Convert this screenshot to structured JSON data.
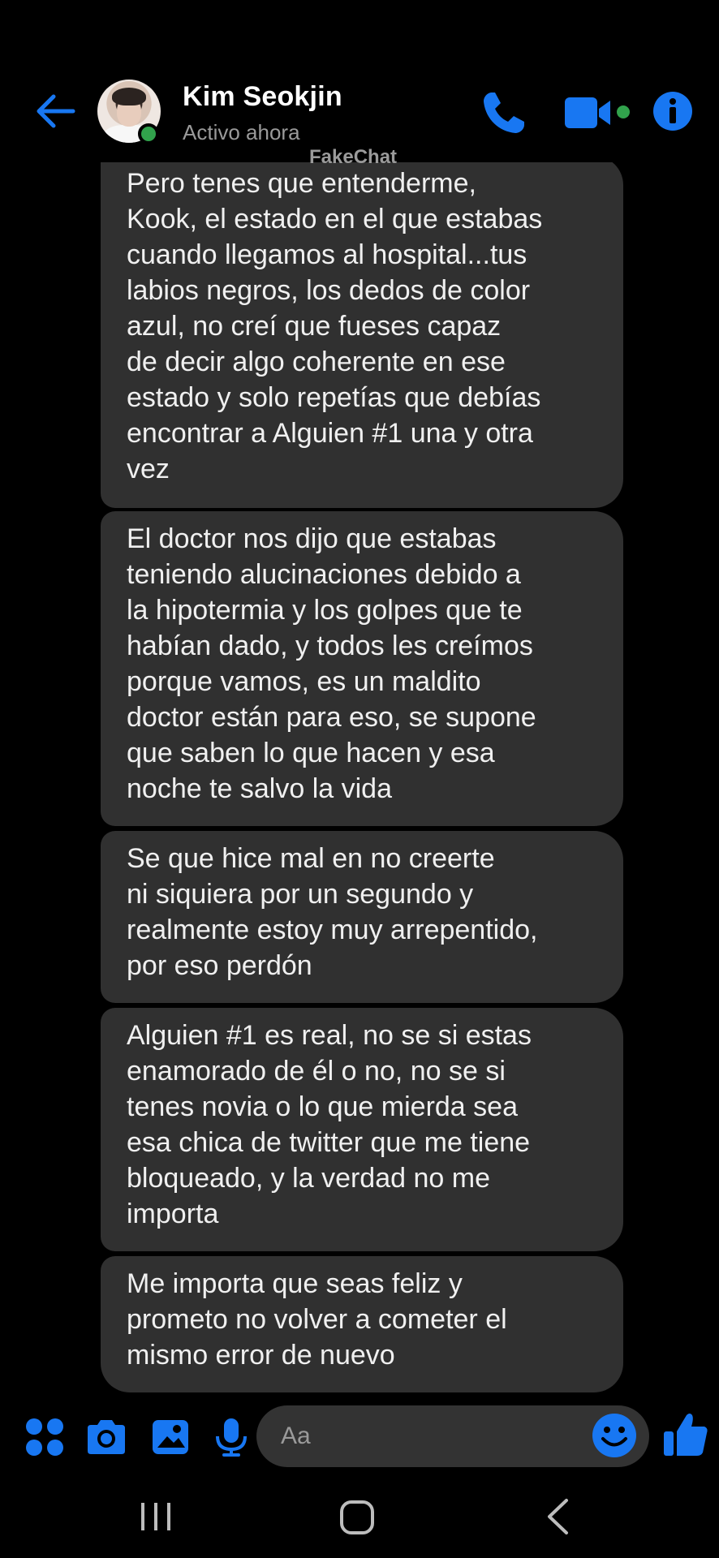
{
  "header": {
    "contact_name": "Kim Seokjin",
    "status": "Activo ahora",
    "watermark": "FakeChat",
    "icons": [
      "back-arrow-icon",
      "phone-icon",
      "video-camera-icon",
      "info-icon"
    ]
  },
  "messages": [
    {
      "text": "Pero tenes que entenderme,\nKook, el estado en el que estabas\ncuando llegamos al hospital...tus\nlabios negros, los dedos de color\nazul, no creí que fueses capaz\nde decir algo coherente en ese\nestado y solo repetías que debías\nencontrar a Alguien #1 una y otra\nvez"
    },
    {
      "text": "El doctor nos dijo que estabas\nteniendo alucinaciones debido a\nla hipotermia y los golpes que te\nhabían dado, y todos les creímos\nporque vamos, es un maldito\ndoctor están para eso, se supone\nque saben lo que hacen y esa\nnoche te salvo la vida"
    },
    {
      "text": "Se que hice mal en no creerte\nni siquiera por un segundo y\nrealmente estoy muy arrepentido,\npor eso perdón"
    },
    {
      "text": "Alguien #1 es real, no se si estas\nenamorado de él o no, no se si\ntenes novia o lo que mierda sea\nesa chica de twitter que me tiene\nbloqueado, y la verdad no me\nimporta"
    },
    {
      "text": "Me importa que seas feliz y\nprometo no volver a cometer el\nmismo error de nuevo"
    }
  ],
  "composer": {
    "placeholder": "Aa",
    "icons": [
      "apps-icon",
      "camera-icon",
      "gallery-icon",
      "microphone-icon",
      "emoji-icon",
      "thumbs-up-icon"
    ]
  },
  "colors": {
    "accent": "#1877f2",
    "bubble": "#303030",
    "background": "#000000",
    "online": "#31a24c"
  }
}
